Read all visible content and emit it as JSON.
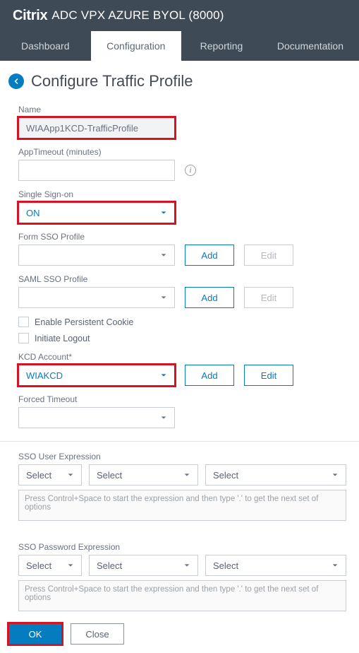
{
  "header": {
    "brand_bold": "Citrix",
    "brand_rest": "ADC VPX AZURE BYOL (8000)"
  },
  "tabs": {
    "dashboard": "Dashboard",
    "configuration": "Configuration",
    "reporting": "Reporting",
    "documentation": "Documentation"
  },
  "page": {
    "title": "Configure Traffic Profile"
  },
  "form": {
    "name_label": "Name",
    "name_value": "WIAApp1KCD-TrafficProfile",
    "apptimeout_label": "AppTimeout (minutes)",
    "apptimeout_value": "",
    "sso_label": "Single Sign-on",
    "sso_value": "ON",
    "formsso_label": "Form SSO Profile",
    "formsso_value": "",
    "samlsso_label": "SAML SSO Profile",
    "samlsso_value": "",
    "enable_cookie_label": "Enable Persistent Cookie",
    "initiate_logout_label": "Initiate Logout",
    "kcd_label": "KCD Account*",
    "kcd_value": "WIAKCD",
    "forced_timeout_label": "Forced Timeout",
    "forced_timeout_value": "",
    "sso_user_expr_label": "SSO User Expression",
    "sso_pass_expr_label": "SSO Password Expression",
    "expr_select": "Select",
    "expr_hint": "Press Control+Space to start the expression and then type '.' to get the next set of options"
  },
  "buttons": {
    "add": "Add",
    "edit": "Edit",
    "ok": "OK",
    "close": "Close"
  }
}
